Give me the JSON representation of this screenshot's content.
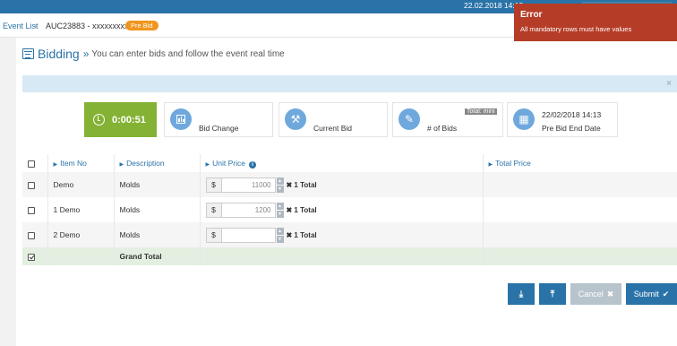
{
  "topbar": {
    "datetime": "22.02.2018 14:12"
  },
  "breadcrumb": {
    "link": "Event List",
    "separator": "›",
    "event_id": "AUC23883 - xxxxxxxxxxx",
    "badge": "Pre Bid"
  },
  "page": {
    "title": "Bidding",
    "arrow": "»",
    "subtitle": "You can enter bids and follow the event real time"
  },
  "infobar": {
    "close": "×"
  },
  "stats": {
    "timer": "0:00:51",
    "bid_change": "Bid Change",
    "current_bid": "Current Bid",
    "num_bids": "# of Bids",
    "total_tag": "Total: mini",
    "end_date_value": "22/02/2018 14:13",
    "end_date_label": "Pre Bid End Date"
  },
  "table": {
    "headers": {
      "item_no": "Item No",
      "description": "Description",
      "unit_price": "Unit Price",
      "total_price": "Total Price"
    },
    "rows": [
      {
        "item": "Demo",
        "description": "Molds",
        "currency": "$",
        "price": "11000",
        "qty": "✖ 1 Total"
      },
      {
        "item": "1 Demo",
        "description": "Molds",
        "currency": "$",
        "price": "1200",
        "qty": "✖ 1 Total"
      },
      {
        "item": "2 Demo",
        "description": "Molds",
        "currency": "$",
        "price": "",
        "qty": "✖ 1 Total"
      }
    ],
    "grand_total": "Grand Total"
  },
  "buttons": {
    "cancel": "Cancel",
    "cancel_icon": "✖",
    "submit": "Submit",
    "submit_icon": "✔"
  },
  "toast": {
    "title": "Error",
    "message": "All mandatory rows must have values"
  },
  "colors": {
    "accent": "#2a73a8",
    "timer": "#84b234",
    "error": "#b53d27",
    "badge": "#f0961e"
  }
}
